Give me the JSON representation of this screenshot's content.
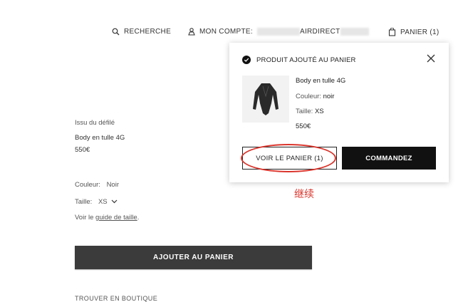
{
  "header": {
    "search_label": "RECHERCHE",
    "search_icon": "search-icon",
    "account_label": "MON COMPTE:",
    "account_name_visible": "AIRDIRECT",
    "account_icon": "user-icon",
    "cart_label": "PANIER (1)",
    "cart_icon": "bag-icon"
  },
  "product": {
    "collection": "Issu du défilé",
    "name": "Body en tulle 4G",
    "price": "550€",
    "color_label": "Couleur:",
    "color_value": "Noir",
    "size_label": "Taille:",
    "size_value": "XS",
    "size_guide_prefix": "Voir le",
    "size_guide_link": "guide de taille",
    "size_guide_suffix": ".",
    "add_to_cart": "AJOUTER AU PANIER",
    "find_in_store": "TROUVER EN BOUTIQUE"
  },
  "popup": {
    "title": "PRODUIT AJOUTÉ AU PANIER",
    "item_name": "Body en tulle 4G",
    "color_label": "Couleur:",
    "color_value": "noir",
    "size_label": "Taille:",
    "size_value": "XS",
    "price": "550€",
    "view_cart": "VOIR LE PANIER (1)",
    "checkout": "COMMANDEZ"
  },
  "annotation": {
    "text": "继续",
    "color": "#d9342b"
  },
  "colors": {
    "accent_dark": "#111111",
    "button_gray": "#3b3b3b",
    "annotation_red": "#d9342b"
  }
}
